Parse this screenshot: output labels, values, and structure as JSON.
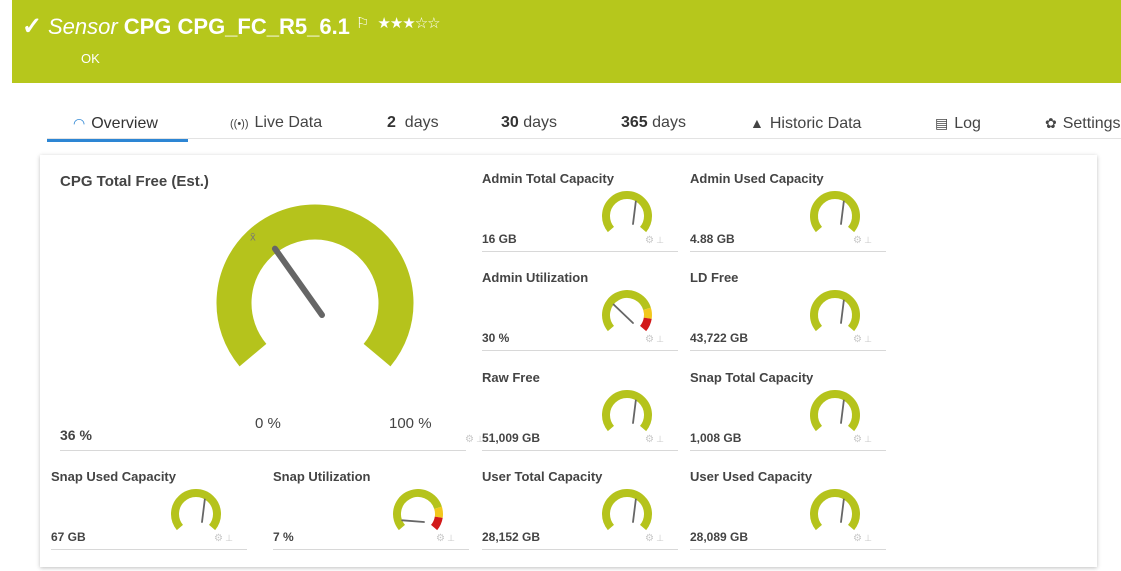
{
  "header": {
    "check": "✓",
    "kind": "Sensor",
    "name": "CPG CPG_FC_R5_6.1",
    "flag": "⚐",
    "stars": "★★★☆☆",
    "status": "OK",
    "bg": "#b6c71c"
  },
  "tabs": [
    {
      "icon": "◠",
      "num": "",
      "label": "Overview"
    },
    {
      "icon": "((•))",
      "num": "",
      "label": "Live Data"
    },
    {
      "icon": "",
      "num": "2",
      "label": "days"
    },
    {
      "icon": "",
      "num": "30",
      "label": "days"
    },
    {
      "icon": "",
      "num": "365",
      "label": "days"
    },
    {
      "icon": "▲",
      "num": "",
      "label": "Historic Data"
    },
    {
      "icon": "▤",
      "num": "",
      "label": "Log"
    },
    {
      "icon": "✿",
      "num": "",
      "label": "Settings"
    }
  ],
  "gauge_colors": {
    "ok": "#b5c31c",
    "warning": "#f2c81c",
    "error": "#d21a1a",
    "needle": "#666666"
  },
  "main_gauge": {
    "label": "CPG Total Free (Est.)",
    "value": "36 %",
    "level": 0.36,
    "mean_symbol": "x̄",
    "scale_min": "0 %",
    "scale_max": "100 %"
  },
  "small_gauges": [
    {
      "label": "Admin Total Capacity",
      "value": "16 GB",
      "level": 0.62,
      "zones": false
    },
    {
      "label": "Admin Used Capacity",
      "value": "4.88 GB",
      "level": 0.62,
      "zones": false
    },
    {
      "label": "Admin Utilization",
      "value": "30 %",
      "level": 0.3,
      "zones": true
    },
    {
      "label": "LD Free",
      "value": "43,722 GB",
      "level": 0.62,
      "zones": false
    },
    {
      "label": "Raw Free",
      "value": "51,009 GB",
      "level": 0.62,
      "zones": false
    },
    {
      "label": "Snap Total Capacity",
      "value": "1,008 GB",
      "level": 0.62,
      "zones": false
    },
    {
      "label": "Snap Used Capacity",
      "value": "67 GB",
      "level": 0.62,
      "zones": false
    },
    {
      "label": "Snap Utilization",
      "value": "7 %",
      "level": 0.07,
      "zones": true
    },
    {
      "label": "User Total Capacity",
      "value": "28,152 GB",
      "level": 0.62,
      "zones": false
    },
    {
      "label": "User Used Capacity",
      "value": "28,089 GB",
      "level": 0.62,
      "zones": false
    }
  ],
  "card_icons": {
    "settings": "⚙",
    "pin": "⊥"
  }
}
